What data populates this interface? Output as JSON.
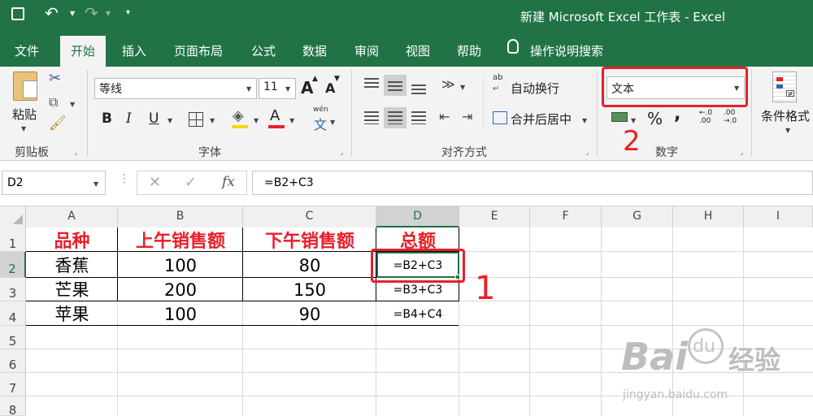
{
  "title_bar": {
    "title": "新建 Microsoft Excel 工作表  -  Excel"
  },
  "tabs": [
    "文件",
    "开始",
    "插入",
    "页面布局",
    "公式",
    "数据",
    "审阅",
    "视图",
    "帮助"
  ],
  "tell_me": "操作说明搜索",
  "clipboard": {
    "paste": "粘贴",
    "group": "剪贴板"
  },
  "font": {
    "name": "等线",
    "size": "11",
    "bold": "B",
    "italic": "I",
    "underline": "U",
    "font_color_letter": "A",
    "grow_letter": "A",
    "shrink_letter": "A",
    "phonetic": "wén",
    "phonetic_char": "文",
    "group": "字体"
  },
  "alignment": {
    "wrap": "自动换行",
    "merge": "合并后居中",
    "group": "对齐方式",
    "wrap_icon": "ab"
  },
  "number": {
    "format": "文本",
    "percent": "%",
    "comma": ",",
    "group": "数字"
  },
  "styles": {
    "conditional": "条件格式"
  },
  "namebox": "D2",
  "formula": "=B2+C3",
  "columns": [
    "A",
    "B",
    "C",
    "D",
    "E",
    "F",
    "G",
    "H",
    "I"
  ],
  "rows": [
    "1",
    "2",
    "3",
    "4",
    "5",
    "6",
    "7",
    "8"
  ],
  "table": {
    "headers": [
      "品种",
      "上午销售额",
      "下午销售额",
      "总额"
    ],
    "rows": [
      [
        "香蕉",
        "100",
        "80",
        "=B2+C3"
      ],
      [
        "芒果",
        "200",
        "150",
        "=B3+C3"
      ],
      [
        "苹果",
        "100",
        "90",
        "=B4+C4"
      ]
    ]
  },
  "annotations": {
    "one": "1",
    "two": "2"
  },
  "watermark": {
    "brand": "Bai",
    "du": "du",
    "cn": "经验",
    "url": "jingyan.baidu.com"
  },
  "colors": {
    "excel_green": "#217346",
    "header_red": "#e8202a",
    "annotation_red": "#e8202a"
  }
}
